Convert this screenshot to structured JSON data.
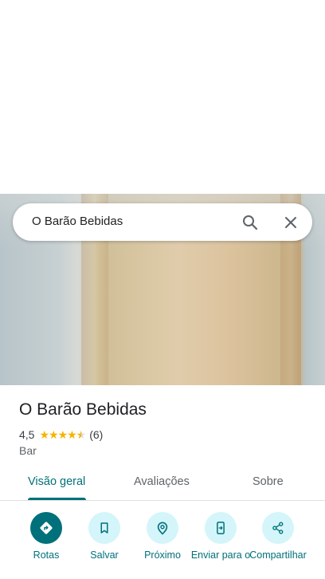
{
  "search": {
    "query": "O Barão Bebidas"
  },
  "place": {
    "name": "O Barão Bebidas",
    "rating": "4,5",
    "stars": 4.5,
    "review_count": "(6)",
    "category": "Bar"
  },
  "tabs": [
    {
      "label": "Visão geral",
      "active": true
    },
    {
      "label": "Avaliações",
      "active": false
    },
    {
      "label": "Sobre",
      "active": false
    }
  ],
  "actions": [
    {
      "label": "Rotas",
      "icon": "directions-icon"
    },
    {
      "label": "Salvar",
      "icon": "bookmark-icon"
    },
    {
      "label": "Próximo",
      "icon": "nearby-icon"
    },
    {
      "label": "Enviar para o",
      "icon": "send-to-phone-icon"
    },
    {
      "label": "Compartilhar",
      "icon": "share-icon"
    }
  ],
  "colors": {
    "accent": "#00707a",
    "chip_bg": "#d4f5fa",
    "star": "#f5b400"
  }
}
